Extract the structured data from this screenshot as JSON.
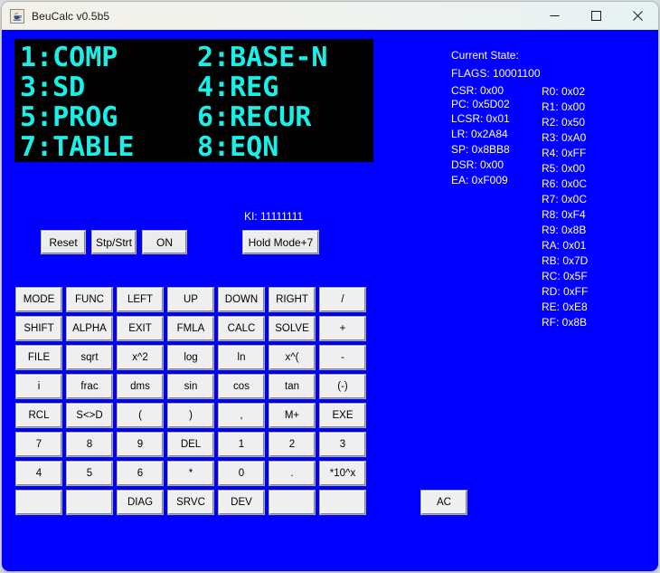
{
  "window": {
    "title": "BeuCalc v0.5b5",
    "icon": "java-coffee-cup-icon",
    "controls": {
      "minimize": "minimize-icon",
      "maximize": "maximize-icon",
      "close": "close-icon"
    }
  },
  "colors": {
    "surface": "#0000ff",
    "lcd_background": "#000000",
    "lcd_text": "#18f0e8",
    "button_face": "#efefef",
    "panel_text": "#ffffff"
  },
  "lcd": {
    "rows": [
      {
        "left": "1:COMP",
        "right": "2:BASE-N"
      },
      {
        "left": "3:SD",
        "right": "4:REG"
      },
      {
        "left": "5:PROG",
        "right": "6:RECUR"
      },
      {
        "left": "7:TABLE",
        "right": "8:EQN"
      }
    ]
  },
  "ki": {
    "label": "KI: 11111111"
  },
  "controls": {
    "reset": "Reset",
    "stp_strt": "Stp/Strt",
    "on": "ON",
    "hold_mode": "Hold Mode+7"
  },
  "keypad": {
    "rows": [
      [
        "MODE",
        "FUNC",
        "LEFT",
        "UP",
        "DOWN",
        "RIGHT",
        "/"
      ],
      [
        "SHIFT",
        "ALPHA",
        "EXIT",
        "FMLA",
        "CALC",
        "SOLVE",
        "+"
      ],
      [
        "FILE",
        "sqrt",
        "x^2",
        "log",
        "ln",
        "x^(",
        "-"
      ],
      [
        "i",
        "frac",
        "dms",
        "sin",
        "cos",
        "tan",
        "(-)"
      ],
      [
        "RCL",
        "S<>D",
        "(",
        ")",
        ",",
        "M+",
        "EXE"
      ],
      [
        "7",
        "8",
        "9",
        "DEL",
        "1",
        "2",
        "3"
      ],
      [
        "4",
        "5",
        "6",
        "*",
        "0",
        ".",
        "*10^x"
      ],
      [
        "",
        "",
        "DIAG",
        "SRVC",
        "DEV",
        "",
        "",
        "AC"
      ]
    ]
  },
  "state": {
    "title": "Current State:",
    "flags": "FLAGS: 10001100",
    "left": [
      "CSR: 0x00",
      "PC: 0x5D02",
      "LCSR: 0x01",
      "LR: 0x2A84",
      "SP: 0x8BB8",
      "DSR: 0x00",
      "EA: 0xF009"
    ],
    "right": [
      "R0: 0x02",
      "R1: 0x00",
      "R2: 0x50",
      "R3: 0xA0",
      "R4: 0xFF",
      "R5: 0x00",
      "R6: 0x0C",
      "R7: 0x0C",
      "R8: 0xF4",
      "R9: 0x8B",
      "RA: 0x01",
      "RB: 0x7D",
      "RC: 0x5F",
      "RD: 0xFF",
      "RE: 0xE8",
      "RF: 0x8B"
    ]
  }
}
